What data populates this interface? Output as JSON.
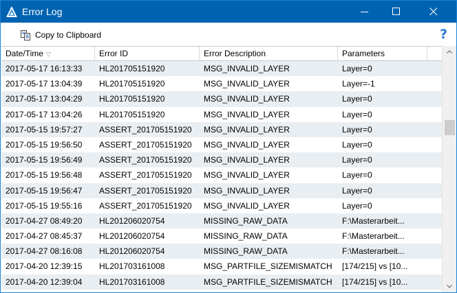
{
  "window": {
    "title": "Error Log",
    "accent_color": "#0063b1"
  },
  "toolbar": {
    "copy_label": "Copy to Clipboard",
    "copy_icon": "clipboard-icon",
    "help_glyph": "?"
  },
  "table": {
    "columns": [
      {
        "label": "Date/Time",
        "sorted": "descending"
      },
      {
        "label": "Error ID"
      },
      {
        "label": "Error Description"
      },
      {
        "label": "Parameters"
      }
    ],
    "rows": [
      {
        "datetime": "2017-05-17 16:13:33",
        "id": "HL201705151920",
        "desc": "MSG_INVALID_LAYER",
        "params": "Layer=0"
      },
      {
        "datetime": "2017-05-17 13:04:39",
        "id": "HL201705151920",
        "desc": "MSG_INVALID_LAYER",
        "params": "Layer=-1"
      },
      {
        "datetime": "2017-05-17 13:04:29",
        "id": "HL201705151920",
        "desc": "MSG_INVALID_LAYER",
        "params": "Layer=0"
      },
      {
        "datetime": "2017-05-17 13:04:26",
        "id": "HL201705151920",
        "desc": "MSG_INVALID_LAYER",
        "params": "Layer=0"
      },
      {
        "datetime": "2017-05-15 19:57:27",
        "id": "ASSERT_201705151920",
        "desc": "MSG_INVALID_LAYER",
        "params": "Layer=0"
      },
      {
        "datetime": "2017-05-15 19:56:50",
        "id": "ASSERT_201705151920",
        "desc": "MSG_INVALID_LAYER",
        "params": "Layer=0"
      },
      {
        "datetime": "2017-05-15 19:56:49",
        "id": "ASSERT_201705151920",
        "desc": "MSG_INVALID_LAYER",
        "params": "Layer=0"
      },
      {
        "datetime": "2017-05-15 19:56:48",
        "id": "ASSERT_201705151920",
        "desc": "MSG_INVALID_LAYER",
        "params": "Layer=0"
      },
      {
        "datetime": "2017-05-15 19:56:47",
        "id": "ASSERT_201705151920",
        "desc": "MSG_INVALID_LAYER",
        "params": "Layer=0"
      },
      {
        "datetime": "2017-05-15 19:55:16",
        "id": "ASSERT_201705151920",
        "desc": "MSG_INVALID_LAYER",
        "params": "Layer=0"
      },
      {
        "datetime": "2017-04-27 08:49:20",
        "id": "HL201206020754",
        "desc": "MISSING_RAW_DATA",
        "params": "F:\\Masterarbeit..."
      },
      {
        "datetime": "2017-04-27 08:45:37",
        "id": "HL201206020754",
        "desc": "MISSING_RAW_DATA",
        "params": "F:\\Masterarbeit..."
      },
      {
        "datetime": "2017-04-27 08:16:08",
        "id": "HL201206020754",
        "desc": "MISSING_RAW_DATA",
        "params": "F:\\Masterarbeit..."
      },
      {
        "datetime": "2017-04-20 12:39:15",
        "id": "HL201703161008",
        "desc": "MSG_PARTFILE_SIZEMISMATCH",
        "params": "[174/215] vs [10..."
      },
      {
        "datetime": "2017-04-20 12:39:04",
        "id": "HL201703161008",
        "desc": "MSG_PARTFILE_SIZEMISMATCH",
        "params": "[174/215] vs [10..."
      }
    ]
  }
}
